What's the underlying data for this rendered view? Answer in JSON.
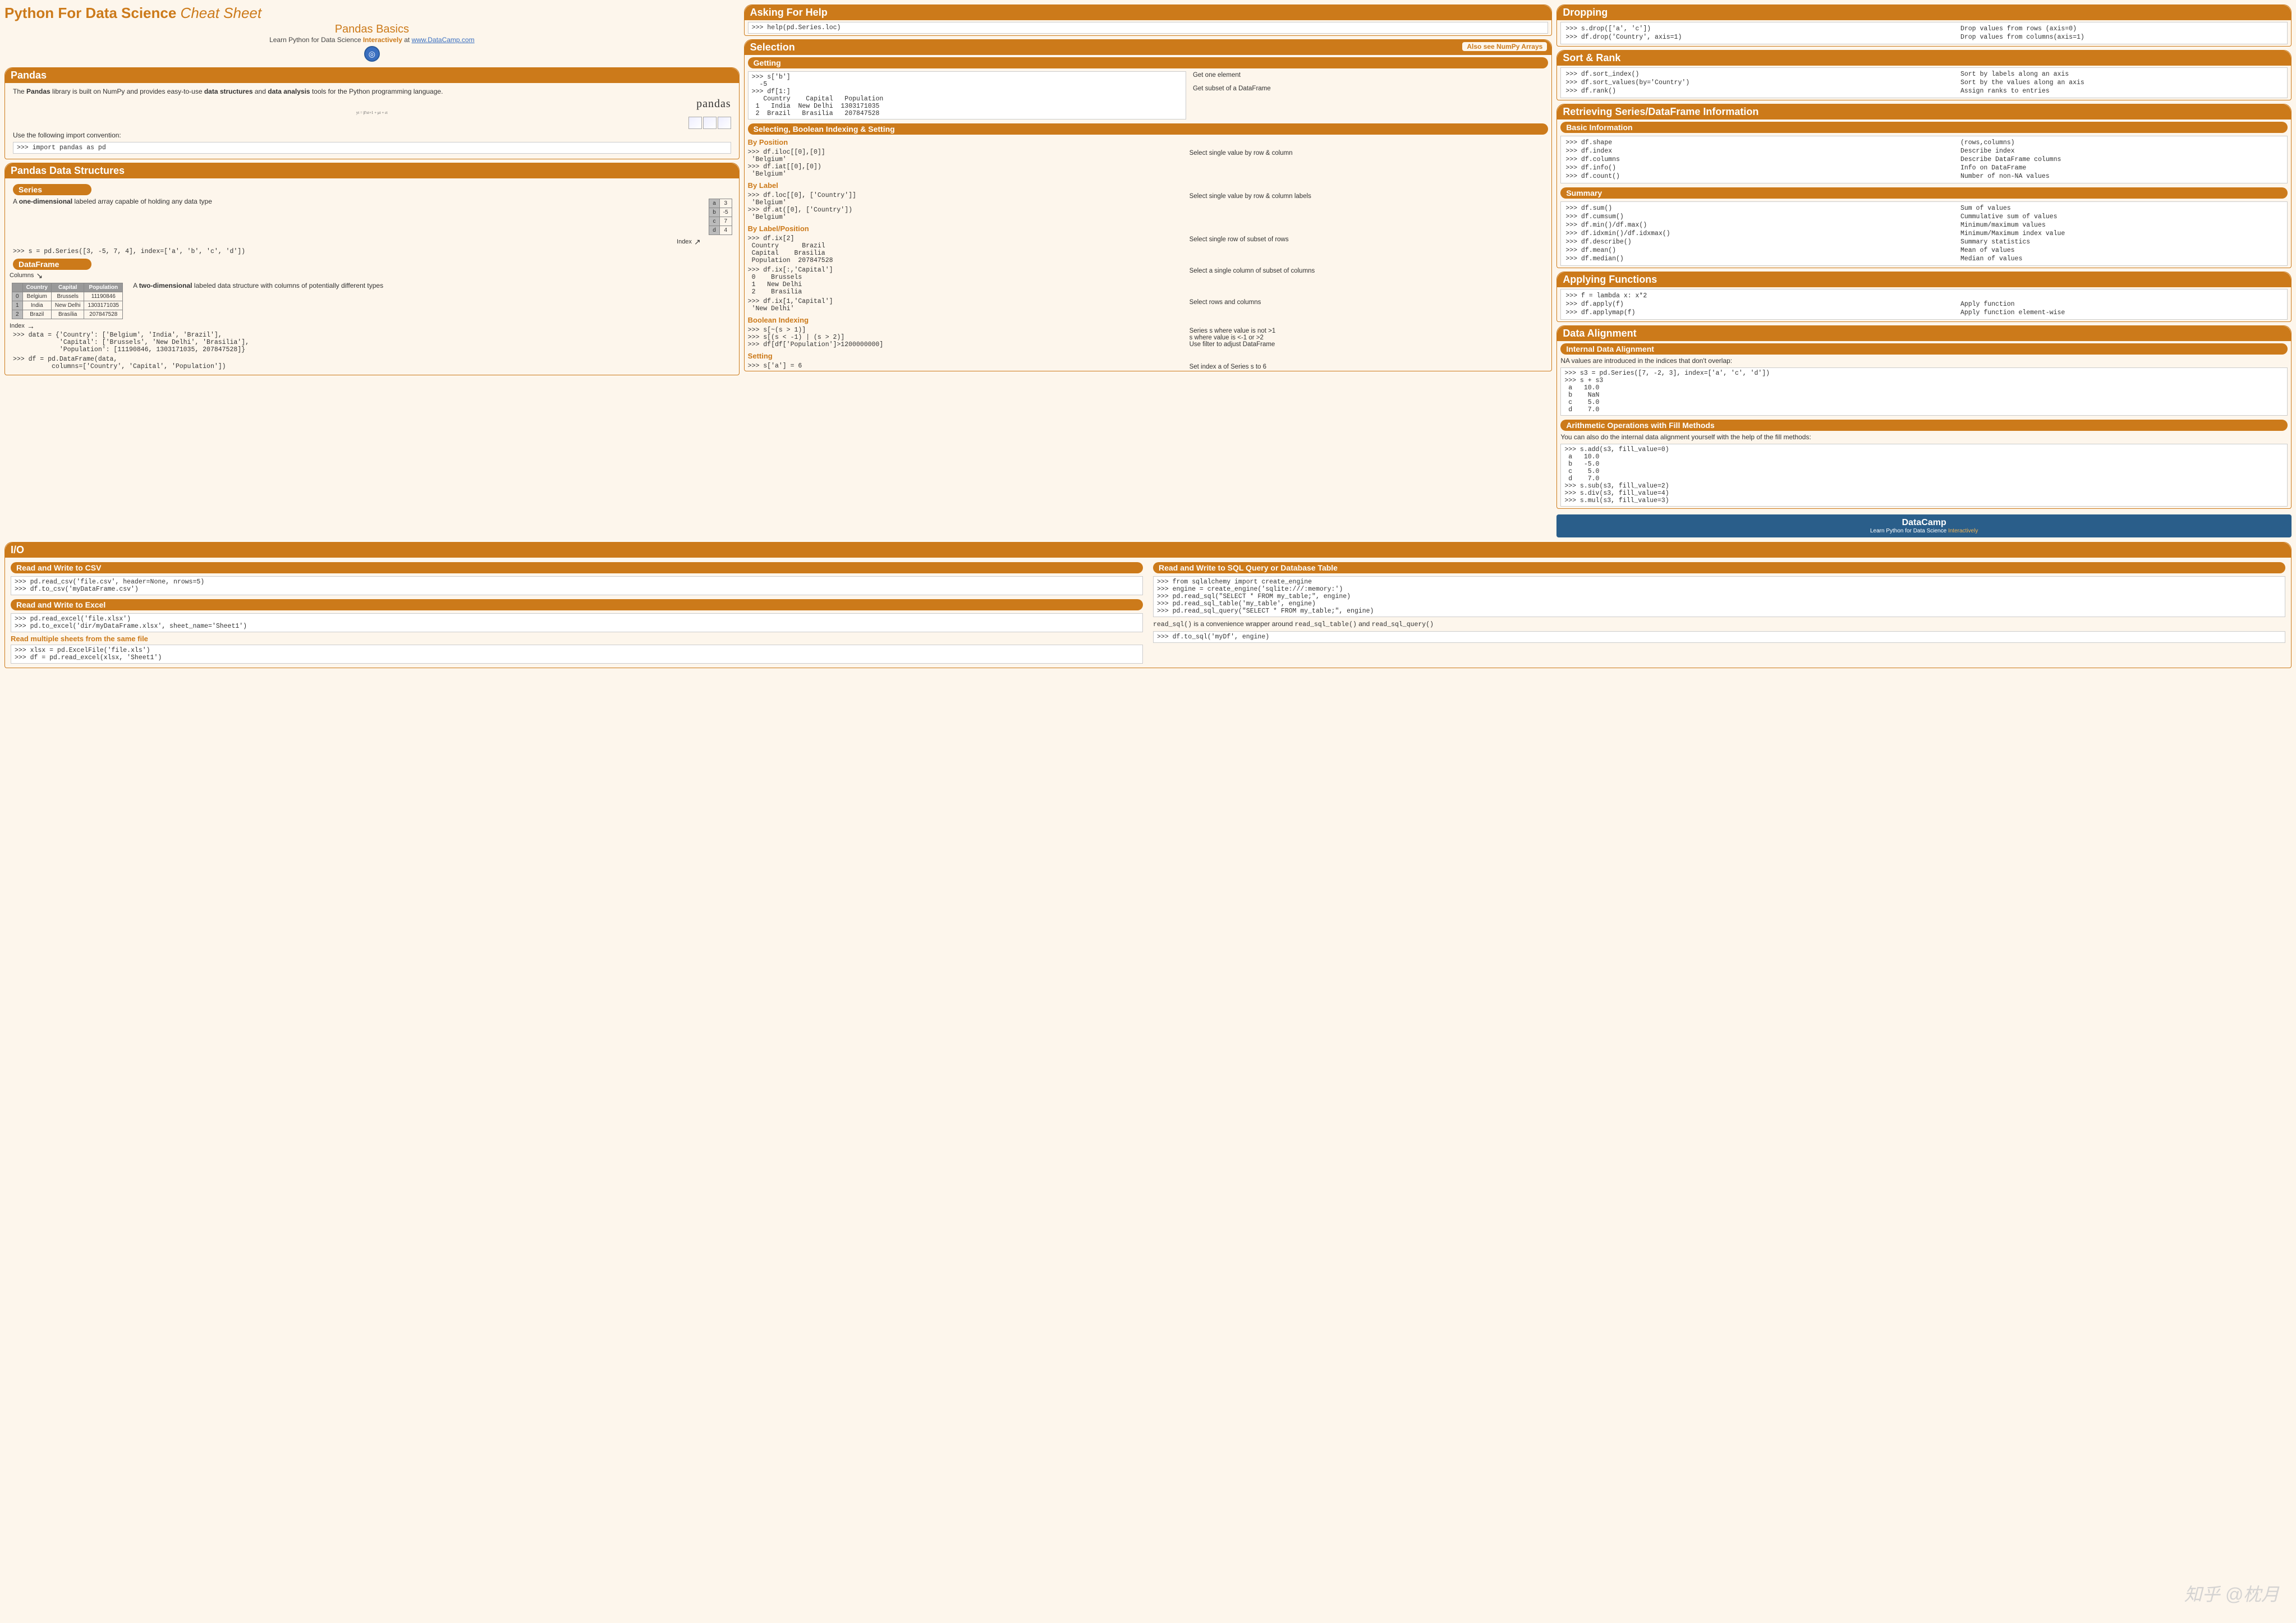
{
  "header": {
    "title_a": "Python For Data Science",
    "title_b": "Cheat Sheet",
    "subtitle": "Pandas Basics",
    "learn_pre": "Learn Python for Data Science ",
    "learn_inter": "Interactively",
    "learn_at": " at ",
    "learn_link": "www.DataCamp.com"
  },
  "pandas_intro": {
    "h": "Pandas",
    "p1a": "The ",
    "p1b": "Pandas",
    "p1c": " library is built on NumPy and provides easy-to-use ",
    "p1d": "data structures",
    "p1e": " and ",
    "p1f": "data analysis",
    "p1g": " tools for the Python programming language.",
    "logo_text": "pandas",
    "logo_sub": "yt = β'xt+1 + μt + εt",
    "p2": "Use the following import convention:",
    "code": ">>> import pandas as pd"
  },
  "ds": {
    "h": "Pandas Data Structures",
    "series_h": "Series",
    "series_p1": "A one-dimensional labeled array capable of holding any data type",
    "series_idx": "Index",
    "series_tbl": [
      [
        "a",
        "3"
      ],
      [
        "b",
        "-5"
      ],
      [
        "c",
        "7"
      ],
      [
        "d",
        "4"
      ]
    ],
    "series_code": ">>> s = pd.Series([3, -5, 7, 4], index=['a', 'b', 'c', 'd'])",
    "df_h": "DataFrame",
    "df_cols_label": "Columns",
    "df_idx_label": "Index",
    "df_p": "A two-dimensional labeled data structure with columns of potentially different types",
    "df_headers": [
      "",
      "Country",
      "Capital",
      "Population"
    ],
    "df_rows": [
      [
        "0",
        "Belgium",
        "Brussels",
        "11190846"
      ],
      [
        "1",
        "India",
        "New Delhi",
        "1303171035"
      ],
      [
        "2",
        "Brazil",
        "Brasília",
        "207847528"
      ]
    ],
    "df_code1": ">>> data = {'Country': ['Belgium', 'India', 'Brazil'],\n            'Capital': ['Brussels', 'New Delhi', 'Brasilia'],\n            'Population': [11190846, 1303171035, 207847528]}",
    "df_code2": ">>> df = pd.DataFrame(data,\n          columns=['Country', 'Capital', 'Population'])"
  },
  "io": {
    "h": "I/O",
    "csv_h": "Read and Write to CSV",
    "csv_code": ">>> pd.read_csv('file.csv', header=None, nrows=5)\n>>> df.to_csv('myDataFrame.csv')",
    "xl_h": "Read and Write to Excel",
    "xl_code": ">>> pd.read_excel('file.xlsx')\n>>> pd.to_excel('dir/myDataFrame.xlsx', sheet_name='Sheet1')",
    "xl_multi_h": "Read multiple sheets from the same file",
    "xl_multi_code": ">>> xlsx = pd.ExcelFile('file.xls')\n>>> df = pd.read_excel(xlsx, 'Sheet1')",
    "sql_h": "Read and Write to SQL Query or Database Table",
    "sql_code": ">>> from sqlalchemy import create_engine\n>>> engine = create_engine('sqlite:///:memory:')\n>>> pd.read_sql(\"SELECT * FROM my_table;\", engine)\n>>> pd.read_sql_table('my_table', engine)\n>>> pd.read_sql_query(\"SELECT * FROM my_table;\", engine)",
    "sql_note_a": "read_sql()",
    "sql_note_b": " is a convenience wrapper around ",
    "sql_note_c": "read_sql_table()",
    "sql_note_d": " and ",
    "sql_note_e": "read_sql_query()",
    "sql_code2": ">>> df.to_sql('myDf', engine)"
  },
  "help": {
    "h": "Asking For Help",
    "code": ">>> help(pd.Series.loc)"
  },
  "selection": {
    "h": "Selection",
    "aside": "Also see NumPy Arrays",
    "getting_h": "Getting",
    "getting_code": ">>> s['b']\n  -5\n>>> df[1:]\n   Country    Capital   Population\n 1   India  New Delhi  1303171035\n 2  Brazil   Brasilia   207847528",
    "getting_desc1": "Get one element",
    "getting_desc2": "Get subset of a DataFrame",
    "sbis_h": "Selecting, Boolean Indexing & Setting",
    "bypos_h": "By Position",
    "bypos_code": ">>> df.iloc[[0],[0]]\n 'Belgium'\n>>> df.iat[[0],[0])\n 'Belgium'",
    "bypos_desc": "Select single value by row & column",
    "bylabel_h": "By Label",
    "bylabel_code": ">>> df.loc[[0], ['Country']]\n 'Belgium'\n>>> df.at([0], ['Country'])\n 'Belgium'",
    "bylabel_desc": "Select single value by row & column labels",
    "bylp_h": "By Label/Position",
    "bylp_code1": ">>> df.ix[2]\n Country      Brazil\n Capital    Brasilia\n Population  207847528",
    "bylp_desc1": "Select single row of subset of rows",
    "bylp_code2": ">>> df.ix[:,'Capital']\n 0    Brussels\n 1   New Delhi\n 2    Brasilia",
    "bylp_desc2": "Select a single column of subset of columns",
    "bylp_code3": ">>> df.ix[1,'Capital']\n 'New Delhi'",
    "bylp_desc3": "Select rows and columns",
    "bool_h": "Boolean Indexing",
    "bool_code": ">>> s[~(s > 1)]\n>>> s[(s < -1) | (s > 2)]\n>>> df[df['Population']>1200000000]",
    "bool_desc1": "Series s where value is not >1",
    "bool_desc2": "s where value is <-1 or >2",
    "bool_desc3": "Use filter to adjust DataFrame",
    "set_h": "Setting",
    "set_code": ">>> s['a'] = 6",
    "set_desc": "Set index a of Series s to 6"
  },
  "dropping": {
    "h": "Dropping",
    "rows": [
      [
        ">>> s.drop(['a', 'c'])",
        "Drop values from rows (axis=0)"
      ],
      [
        ">>> df.drop('Country', axis=1)",
        "Drop values from columns(axis=1)"
      ]
    ]
  },
  "sort": {
    "h": "Sort & Rank",
    "rows": [
      [
        ">>> df.sort_index()",
        "Sort by labels along an axis"
      ],
      [
        ">>> df.sort_values(by='Country')",
        "Sort by the values along an axis"
      ],
      [
        ">>> df.rank()",
        "Assign ranks to entries"
      ]
    ]
  },
  "info": {
    "h": "Retrieving Series/DataFrame Information",
    "basic_h": "Basic Information",
    "basic_rows": [
      [
        ">>> df.shape",
        "(rows,columns)"
      ],
      [
        ">>> df.index",
        "Describe index"
      ],
      [
        ">>> df.columns",
        "Describe DataFrame columns"
      ],
      [
        ">>> df.info()",
        "Info on DataFrame"
      ],
      [
        ">>> df.count()",
        "Number of non-NA values"
      ]
    ],
    "sum_h": "Summary",
    "sum_rows": [
      [
        ">>> df.sum()",
        "Sum of values"
      ],
      [
        ">>> df.cumsum()",
        "Cummulative sum of values"
      ],
      [
        ">>> df.min()/df.max()",
        "Minimum/maximum values"
      ],
      [
        ">>> df.idxmin()/df.idxmax()",
        "Minimum/Maximum index value"
      ],
      [
        ">>> df.describe()",
        "Summary statistics"
      ],
      [
        ">>> df.mean()",
        "Mean of values"
      ],
      [
        ">>> df.median()",
        "Median of values"
      ]
    ]
  },
  "apply": {
    "h": "Applying Functions",
    "rows": [
      [
        ">>> f = lambda x: x*2",
        ""
      ],
      [
        ">>> df.apply(f)",
        "Apply function"
      ],
      [
        ">>> df.applymap(f)",
        "Apply function element-wise"
      ]
    ]
  },
  "align": {
    "h": "Data Alignment",
    "ida_h": "Internal Data Alignment",
    "ida_p": "NA values are introduced in the indices that don't overlap:",
    "ida_code": ">>> s3 = pd.Series([7, -2, 3], index=['a', 'c', 'd'])\n>>> s + s3\n a   10.0\n b    NaN\n c    5.0\n d    7.0",
    "fill_h": "Arithmetic Operations with Fill Methods",
    "fill_p": "You can also do the internal data alignment yourself with the help of the fill methods:",
    "fill_code": ">>> s.add(s3, fill_value=0)\n a   10.0\n b   -5.0\n c    5.0\n d    7.0\n>>> s.sub(s3, fill_value=2)\n>>> s.div(s3, fill_value=4)\n>>> s.mul(s3, fill_value=3)"
  },
  "footer": {
    "big": "DataCamp",
    "small_a": "Learn Python for Data Science ",
    "small_b": "Interactively"
  },
  "watermark": "知乎 @枕月"
}
